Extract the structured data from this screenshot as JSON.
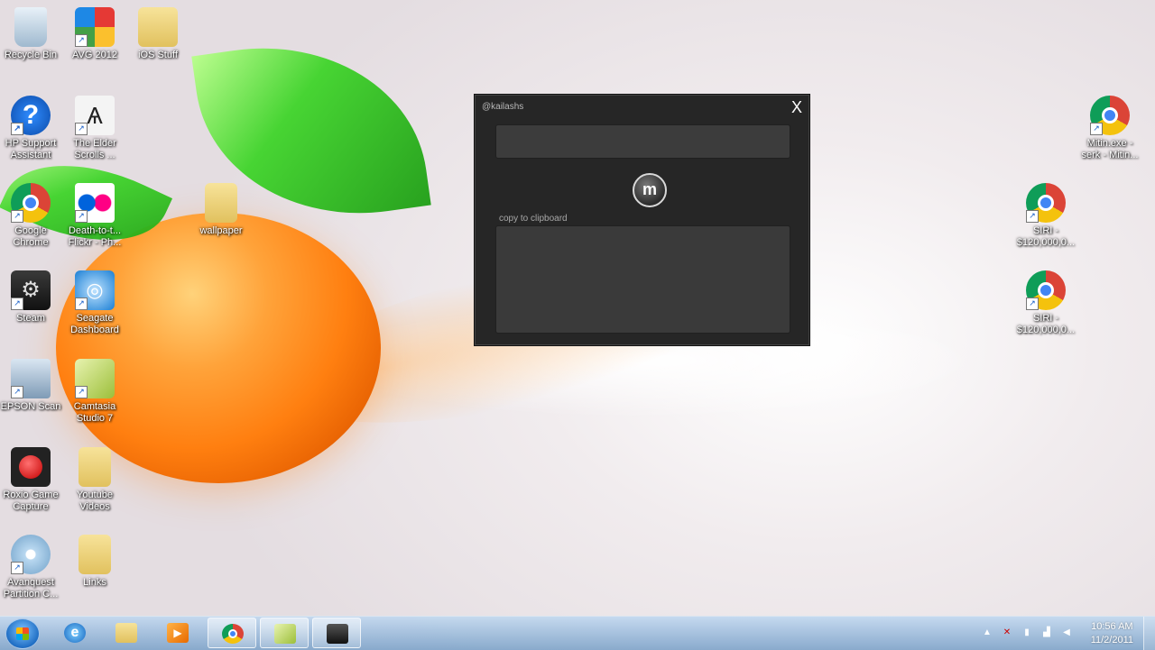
{
  "desktop": {
    "icons": [
      {
        "label": "Recycle Bin"
      },
      {
        "label": "AVG 2012"
      },
      {
        "label": "iOS Stuff"
      },
      {
        "label": "HP Support Assistant"
      },
      {
        "label": "The Elder Scrolls ..."
      },
      {
        "label": "Google Chrome"
      },
      {
        "label": "Death-to-t... Flickr - Ph..."
      },
      {
        "label": "wallpaper"
      },
      {
        "label": "Steam"
      },
      {
        "label": "Seagate Dashboard"
      },
      {
        "label": "EPSON Scan"
      },
      {
        "label": "Camtasia Studio 7"
      },
      {
        "label": "Roxio Game Capture"
      },
      {
        "label": "Youtube Videos"
      },
      {
        "label": "Avanquest Partition C..."
      },
      {
        "label": "Links"
      },
      {
        "label": "Mitin.exe - serk - Mitin..."
      },
      {
        "label": "SIRI - $120,000,0..."
      },
      {
        "label": "SIRI - $120,000,0..."
      }
    ]
  },
  "dialog": {
    "title": "@kailashs",
    "close_label": "X",
    "input_value": "",
    "go_label": "m",
    "copy_label": "copy to clipboard",
    "output_value": ""
  },
  "taskbar": {
    "buttons": [
      {
        "icon": "internet-explorer-icon"
      },
      {
        "icon": "windows-explorer-icon"
      },
      {
        "icon": "media-player-icon"
      },
      {
        "icon": "chrome-icon"
      },
      {
        "icon": "camtasia-icon"
      },
      {
        "icon": "camcorder-icon"
      }
    ],
    "clock_time": "10:56 AM",
    "clock_date": "11/2/2011"
  },
  "colors": {
    "dialog_bg": "#262626",
    "taskbar": "#8fb4d8"
  }
}
